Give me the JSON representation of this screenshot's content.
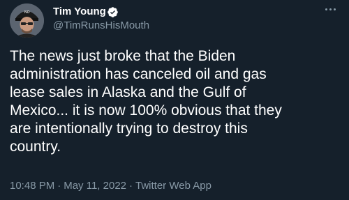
{
  "author": {
    "display_name": "Tim Young",
    "handle": "@TimRunsHisMouth",
    "avatar_hat_text": "NO"
  },
  "tweet": {
    "lines": [
      "The news just broke that the Biden",
      "administration has canceled oil and gas",
      "lease sales in Alaska and the Gulf of",
      "Mexico... it is now 100% obvious that they",
      "are intentionally trying to destroy this",
      "country."
    ]
  },
  "meta": {
    "time": "10:48 PM",
    "separator": "·",
    "date": "May 11, 2022",
    "source": "Twitter Web App"
  },
  "icons": {
    "verified": "verified-badge-icon",
    "more": "more-options-icon"
  },
  "colors": {
    "background": "#15202b",
    "primary_text": "#ffffff",
    "secondary_text": "#8899a6",
    "verified_fill": "#ffffff"
  }
}
